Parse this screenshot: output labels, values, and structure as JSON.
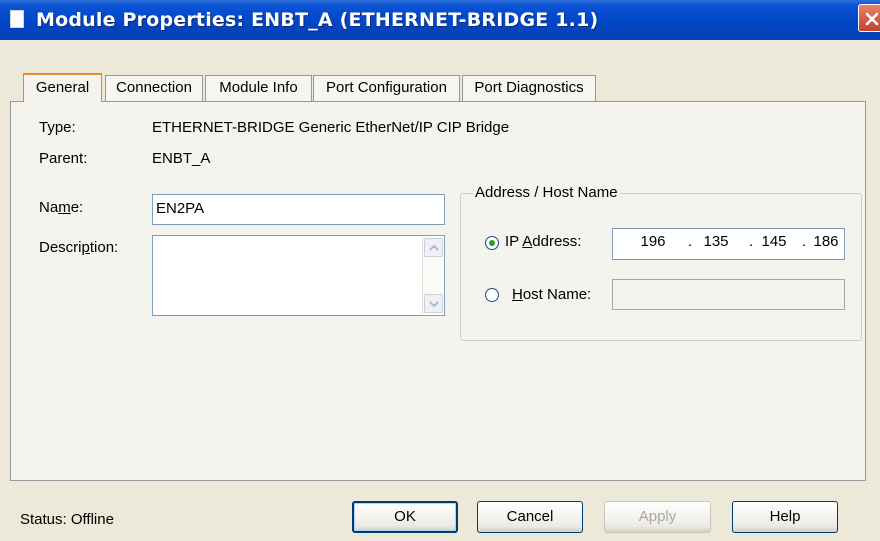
{
  "window": {
    "title": "Module Properties: ENBT_A (ETHERNET-BRIDGE 1.1)",
    "close_icon": "close-icon"
  },
  "tabs": [
    {
      "label": "General",
      "active": true
    },
    {
      "label": "Connection",
      "active": false
    },
    {
      "label": "Module Info",
      "active": false
    },
    {
      "label": "Port Configuration",
      "active": false
    },
    {
      "label": "Port Diagnostics",
      "active": false
    }
  ],
  "general": {
    "type_label": "Type:",
    "type_value": "ETHERNET-BRIDGE Generic EtherNet/IP CIP Bridge",
    "parent_label": "Parent:",
    "parent_value": "ENBT_A",
    "name_label_pre": "Na",
    "name_label_u": "m",
    "name_label_post": "e:",
    "name_value": "EN2PA",
    "description_label_pre": "Descri",
    "description_label_u": "p",
    "description_label_post": "tion:",
    "description_value": ""
  },
  "address_group": {
    "title": "Address / Host Name",
    "ip_radio_label_pre": "IP ",
    "ip_radio_label_u": "A",
    "ip_radio_label_post": "ddress:",
    "ip_selected": true,
    "ip_octets": [
      "196",
      "135",
      "145",
      "186"
    ],
    "host_radio_label_u": "H",
    "host_radio_label_post": "ost Name:",
    "host_selected": false,
    "host_value": ""
  },
  "footer": {
    "status": "Status:  Offline",
    "ok_label": "OK",
    "cancel_label": "Cancel",
    "apply_label": "Apply",
    "help_label": "Help",
    "apply_enabled": false
  },
  "colors": {
    "titlebar": "#0046c6",
    "dialog_bg": "#ece9d8",
    "active_tab_accent": "#e68b2c",
    "radio_dot": "#21a121"
  }
}
